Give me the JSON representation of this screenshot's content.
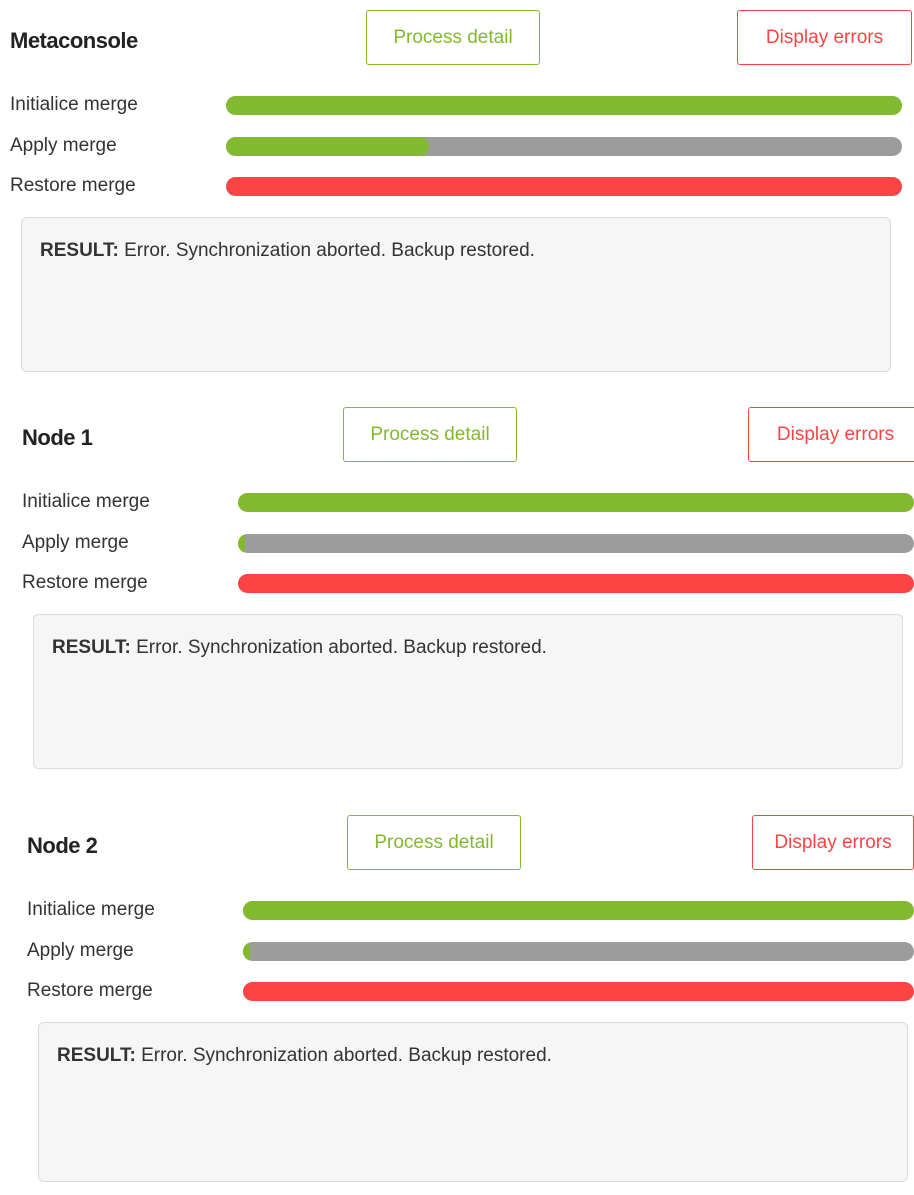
{
  "sections": [
    {
      "title": "Metaconsole",
      "detail_label": "Process detail",
      "errors_label": "Display errors",
      "steps": [
        {
          "label": "Initialice merge",
          "progress": 1.0,
          "color": "#82b92e"
        },
        {
          "label": "Apply merge",
          "progress": 0.3,
          "color": "#82b92e"
        },
        {
          "label": "Restore merge",
          "progress": 1.0,
          "color": "#fc4444"
        }
      ],
      "result_key": "RESULT:",
      "result_text": " Error. Synchronization aborted. Backup restored."
    },
    {
      "title": "Node 1",
      "detail_label": "Process detail",
      "errors_label": "Display errors",
      "steps": [
        {
          "label": "Initialice merge",
          "progress": 1.0,
          "color": "#82b92e"
        },
        {
          "label": "Apply merge",
          "progress": 0.01,
          "color": "#82b92e"
        },
        {
          "label": "Restore merge",
          "progress": 1.0,
          "color": "#fc4444"
        }
      ],
      "result_key": "RESULT:",
      "result_text": " Error. Synchronization aborted. Backup restored."
    },
    {
      "title": "Node 2",
      "detail_label": "Process detail",
      "errors_label": "Display errors",
      "steps": [
        {
          "label": "Initialice merge",
          "progress": 1.0,
          "color": "#82b92e"
        },
        {
          "label": "Apply merge",
          "progress": 0.01,
          "color": "#82b92e"
        },
        {
          "label": "Restore merge",
          "progress": 1.0,
          "color": "#fc4444"
        }
      ],
      "result_key": "RESULT:",
      "result_text": " Error. Synchronization aborted. Backup restored."
    }
  ],
  "colors": {
    "success": "#82b92e",
    "error": "#fc4444",
    "track": "#9c9c9c"
  }
}
